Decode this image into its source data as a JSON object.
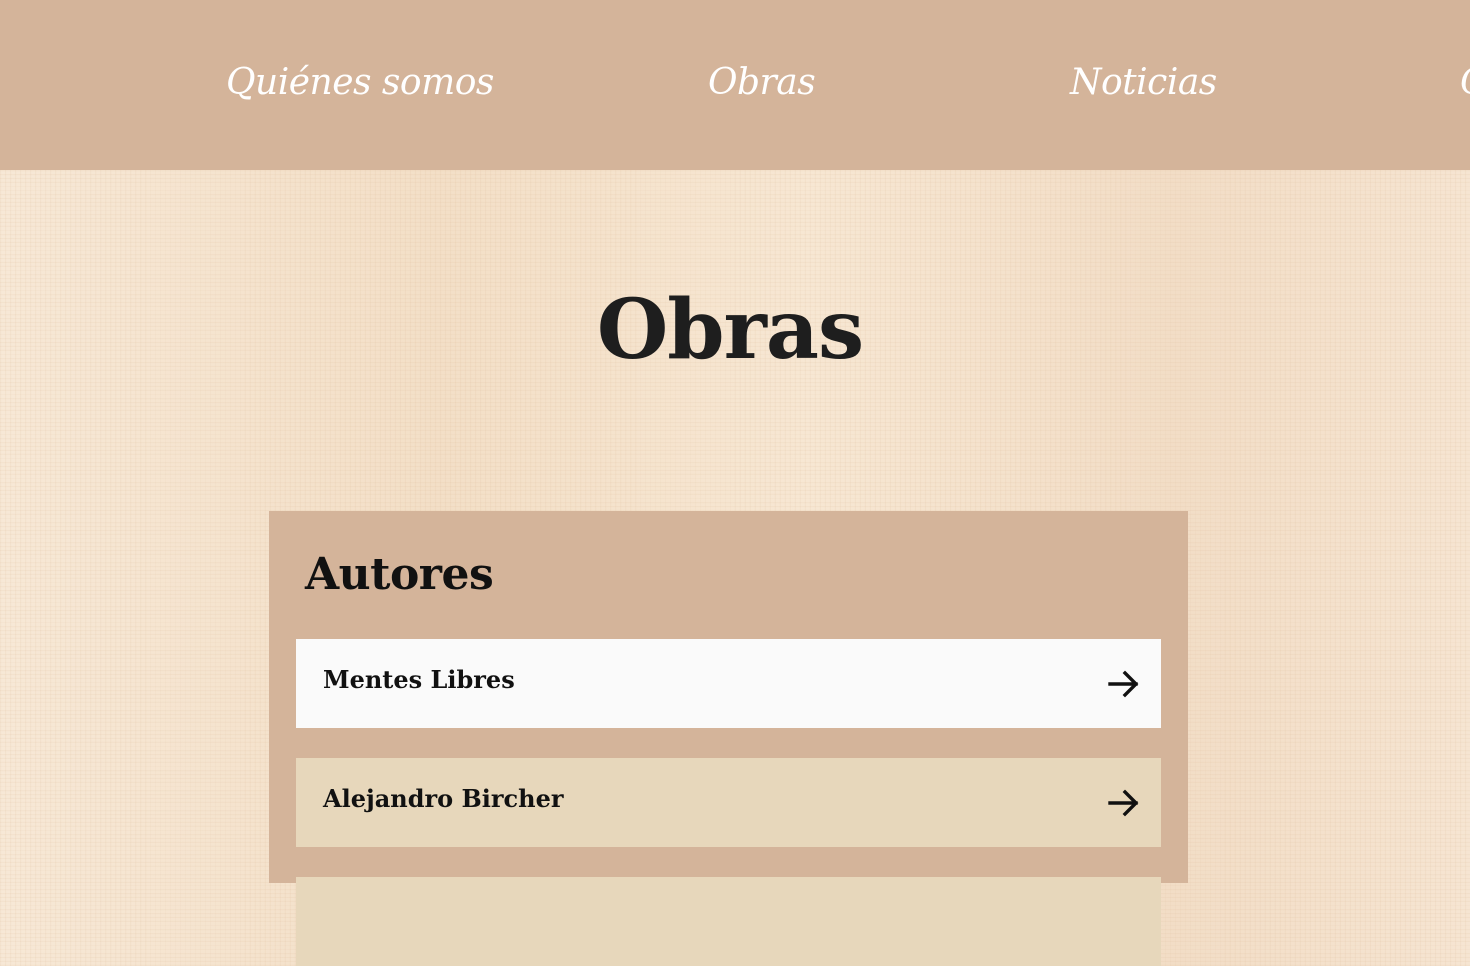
{
  "nav": {
    "items": [
      {
        "label": "Quiénes somos"
      },
      {
        "label": "Obras"
      },
      {
        "label": "Noticias"
      },
      {
        "label": "C"
      }
    ]
  },
  "page": {
    "title": "Obras"
  },
  "authors_panel": {
    "title": "Autores",
    "items": [
      {
        "label": "Mentes Libres",
        "icon": "arrow-right-icon"
      },
      {
        "label": "Alejandro Bircher",
        "icon": "arrow-right-icon"
      },
      {
        "label": "",
        "icon": "arrow-right-icon"
      }
    ]
  },
  "colors": {
    "nav_background": "#d4b49a",
    "panel_background": "#d4b49a",
    "row_highlight": "#fafafa",
    "row_default": "#e7d7bb",
    "page_background": "#f6e5d2",
    "nav_text": "#ffffff",
    "title_text": "#1e1e1e"
  }
}
